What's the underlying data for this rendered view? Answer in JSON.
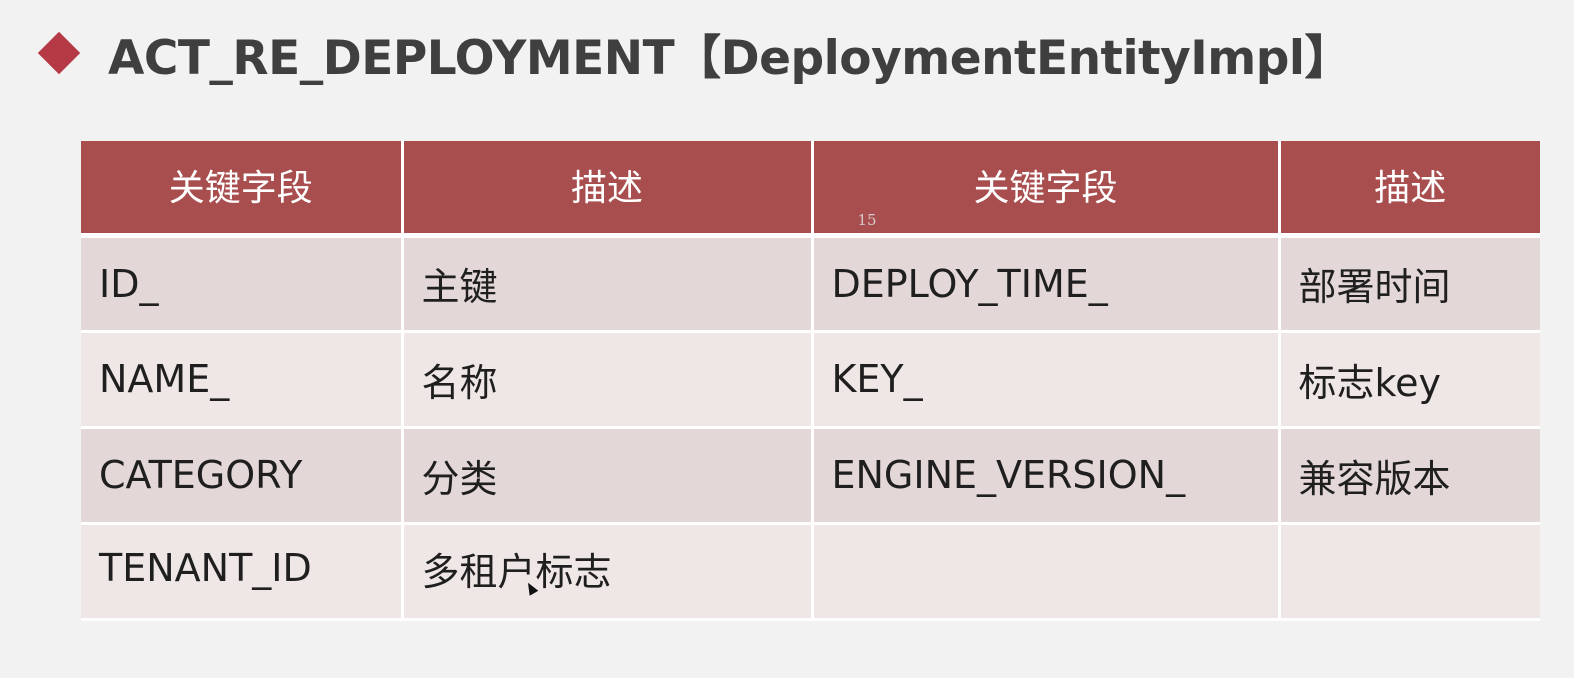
{
  "title": {
    "text": "ACT_RE_DEPLOYMENT【DeploymentEntityImpl】",
    "bullet_color": "#b53a45"
  },
  "table": {
    "header_color": "#a94e4f",
    "headers": [
      "关键字段",
      "描述",
      "关键字段",
      "描述"
    ],
    "header_marker": "15",
    "rows": [
      [
        "ID_",
        "主键",
        "DEPLOY_TIME_",
        "部署时间"
      ],
      [
        "NAME_",
        "名称",
        "KEY_",
        "标志key"
      ],
      [
        "CATEGORY",
        "分类",
        "ENGINE_VERSION_",
        "兼容版本"
      ],
      [
        "TENANT_ID",
        "多租户标志",
        "",
        ""
      ]
    ]
  },
  "cursor": "mouse-pointer-icon"
}
